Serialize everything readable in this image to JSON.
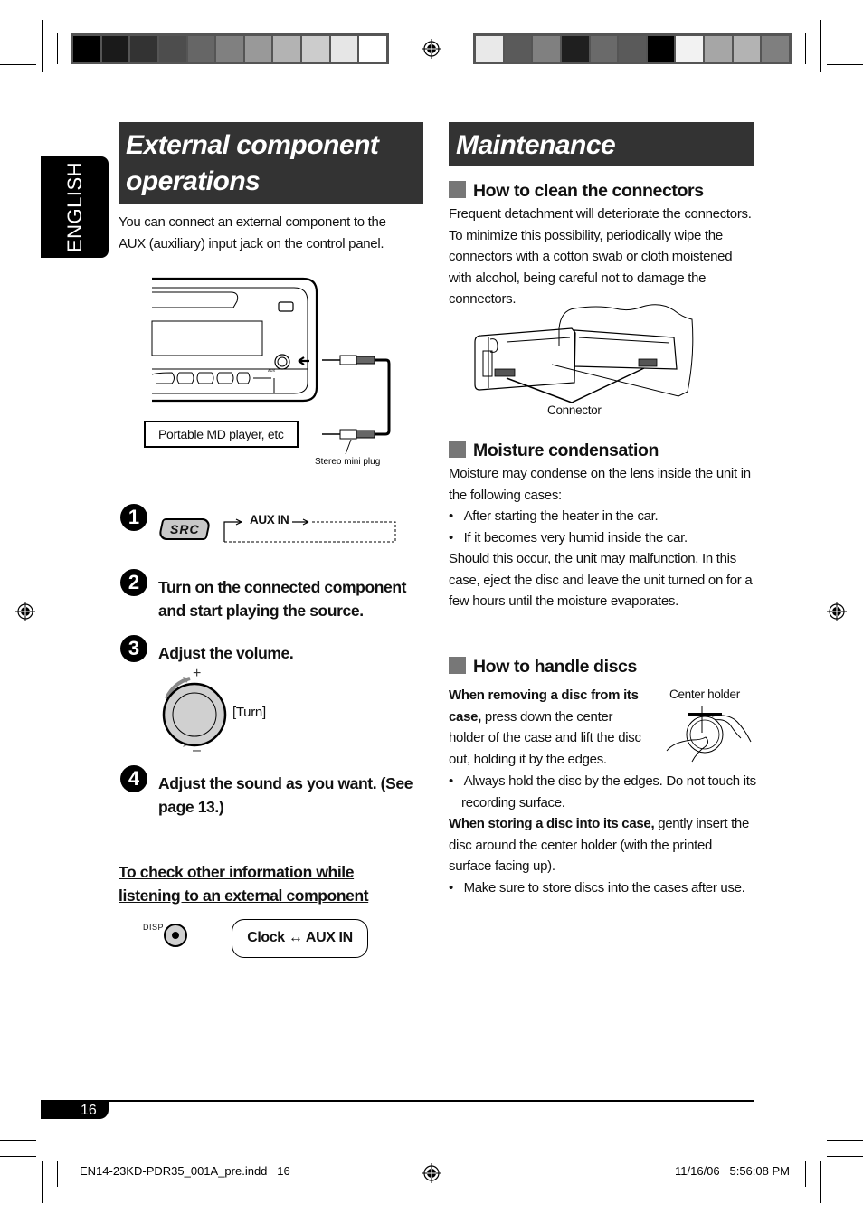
{
  "print_marks": {
    "left_colorbar": [
      "#000000",
      "#1a1a1a",
      "#333333",
      "#4d4d4d",
      "#666666",
      "#808080",
      "#999999",
      "#b3b3b3",
      "#cccccc",
      "#e6e6e6",
      "#ffffff"
    ],
    "right_colorbar": [
      "#e9e9e9",
      "#5a5a5a",
      "#808080",
      "#1f1f1f",
      "#6a6a6a",
      "#5a5a5a",
      "#000000",
      "#f2f2f2",
      "#a6a6a6",
      "#b3b3b3",
      "#7f7f7f"
    ]
  },
  "language_tab": "ENGLISH",
  "left": {
    "title_line1": "External component",
    "title_line2": "operations",
    "intro": "You can connect an external component to the AUX (auxiliary) input jack on the control panel.",
    "diagram": {
      "portable_label": "Portable MD player, etc",
      "plug_label": "Stereo mini plug",
      "aux_label": "AUX"
    },
    "steps": [
      {
        "num": "1",
        "src_button": "SRC",
        "flow_label": "AUX IN"
      },
      {
        "num": "2",
        "text": "Turn on the connected component and start playing the source."
      },
      {
        "num": "3",
        "text": "Adjust the volume.",
        "plus": "+",
        "minus": "–",
        "turn_label": "[Turn]"
      },
      {
        "num": "4",
        "text": "Adjust the sound as you want. (See page 13.)"
      }
    ],
    "check_heading": "To check other information while listening to an external component",
    "disp_label": "DISP",
    "clock_toggle": {
      "left": "Clock",
      "arrow": "↔",
      "right": "AUX IN"
    }
  },
  "right": {
    "title": "Maintenance",
    "sections": [
      {
        "heading": "How to clean the connectors",
        "body": "Frequent detachment will deteriorate the connectors. To minimize this possibility, periodically wipe the connectors with a cotton swab or cloth moistened with alcohol, being careful not to damage the connectors.",
        "figure_label": "Connector"
      },
      {
        "heading": "Moisture condensation",
        "intro": "Moisture may condense on the lens inside the unit in the following cases:",
        "bullets": [
          "After starting the heater in the car.",
          "If it becomes very humid inside the car."
        ],
        "outro": "Should this occur, the unit may malfunction. In this case, eject the disc and leave the unit turned on for a few hours until the moisture evaporates."
      },
      {
        "heading": "How to handle discs",
        "remove_bold": "When removing a disc from its case,",
        "remove_text": " press down the center holder of the case and lift the disc out, holding it by the edges.",
        "figure_label": "Center holder",
        "bullet1": "Always hold the disc by the edges. Do not touch its recording surface.",
        "store_bold": "When storing a disc into its case,",
        "store_text": " gently insert the disc around the center holder (with the printed surface facing up).",
        "bullet2": "Make sure to store discs into the cases after use."
      }
    ]
  },
  "page_number": "16",
  "footer": {
    "file": "EN14-23KD-PDR35_001A_pre.indd   16",
    "date": "11/16/06   5:56:08 PM"
  }
}
